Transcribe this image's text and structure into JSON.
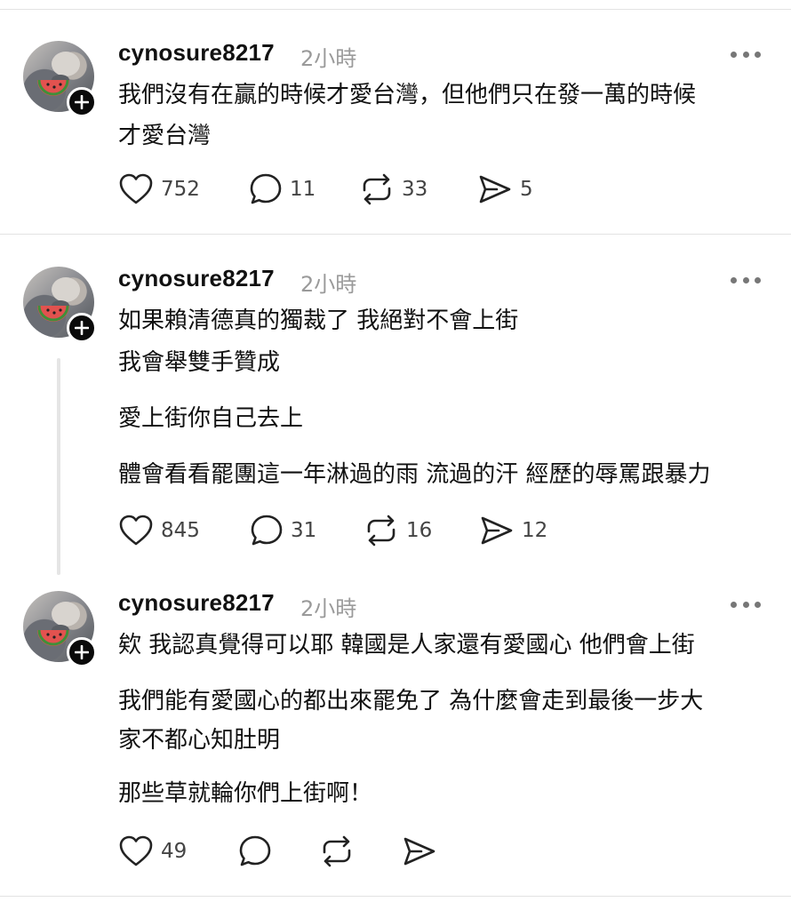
{
  "posts": [
    {
      "username": "cynosure8217",
      "time": "2小時",
      "lines": [
        "我們沒有在贏的時候才愛台灣，但他們只在發一萬的時候",
        "才愛台灣"
      ],
      "likes": "752",
      "comments": "11",
      "reposts": "33",
      "shares": "5"
    },
    {
      "username": "cynosure8217",
      "time": "2小時",
      "lines": [
        "如果賴清德真的獨裁了 我絕對不會上街",
        "我會舉雙手贊成",
        "愛上街你自己去上",
        "體會看看罷團這一年淋過的雨 流過的汗 經歷的辱罵跟暴力"
      ],
      "likes": "845",
      "comments": "31",
      "reposts": "16",
      "shares": "12"
    },
    {
      "username": "cynosure8217",
      "time": "2小時",
      "lines": [
        "欸 我認真覺得可以耶 韓國是人家還有愛國心 他們會上街",
        "我們能有愛國心的都出來罷免了 為什麼會走到最後一步大",
        "家不都心知肚明",
        "那些草就輪你們上街啊！"
      ],
      "likes": "49",
      "comments": "",
      "reposts": "",
      "shares": ""
    }
  ],
  "icons": {
    "like": "heart-icon",
    "comment": "comment-icon",
    "repost": "repost-icon",
    "share": "share-icon",
    "more": "more-icon",
    "follow": "plus-icon"
  },
  "colors": {
    "text": "#111111",
    "muted": "#9a9a9a",
    "badge": "#0a0a0a",
    "divider": "#e3e3e3",
    "watermelon": "#e2524f"
  }
}
